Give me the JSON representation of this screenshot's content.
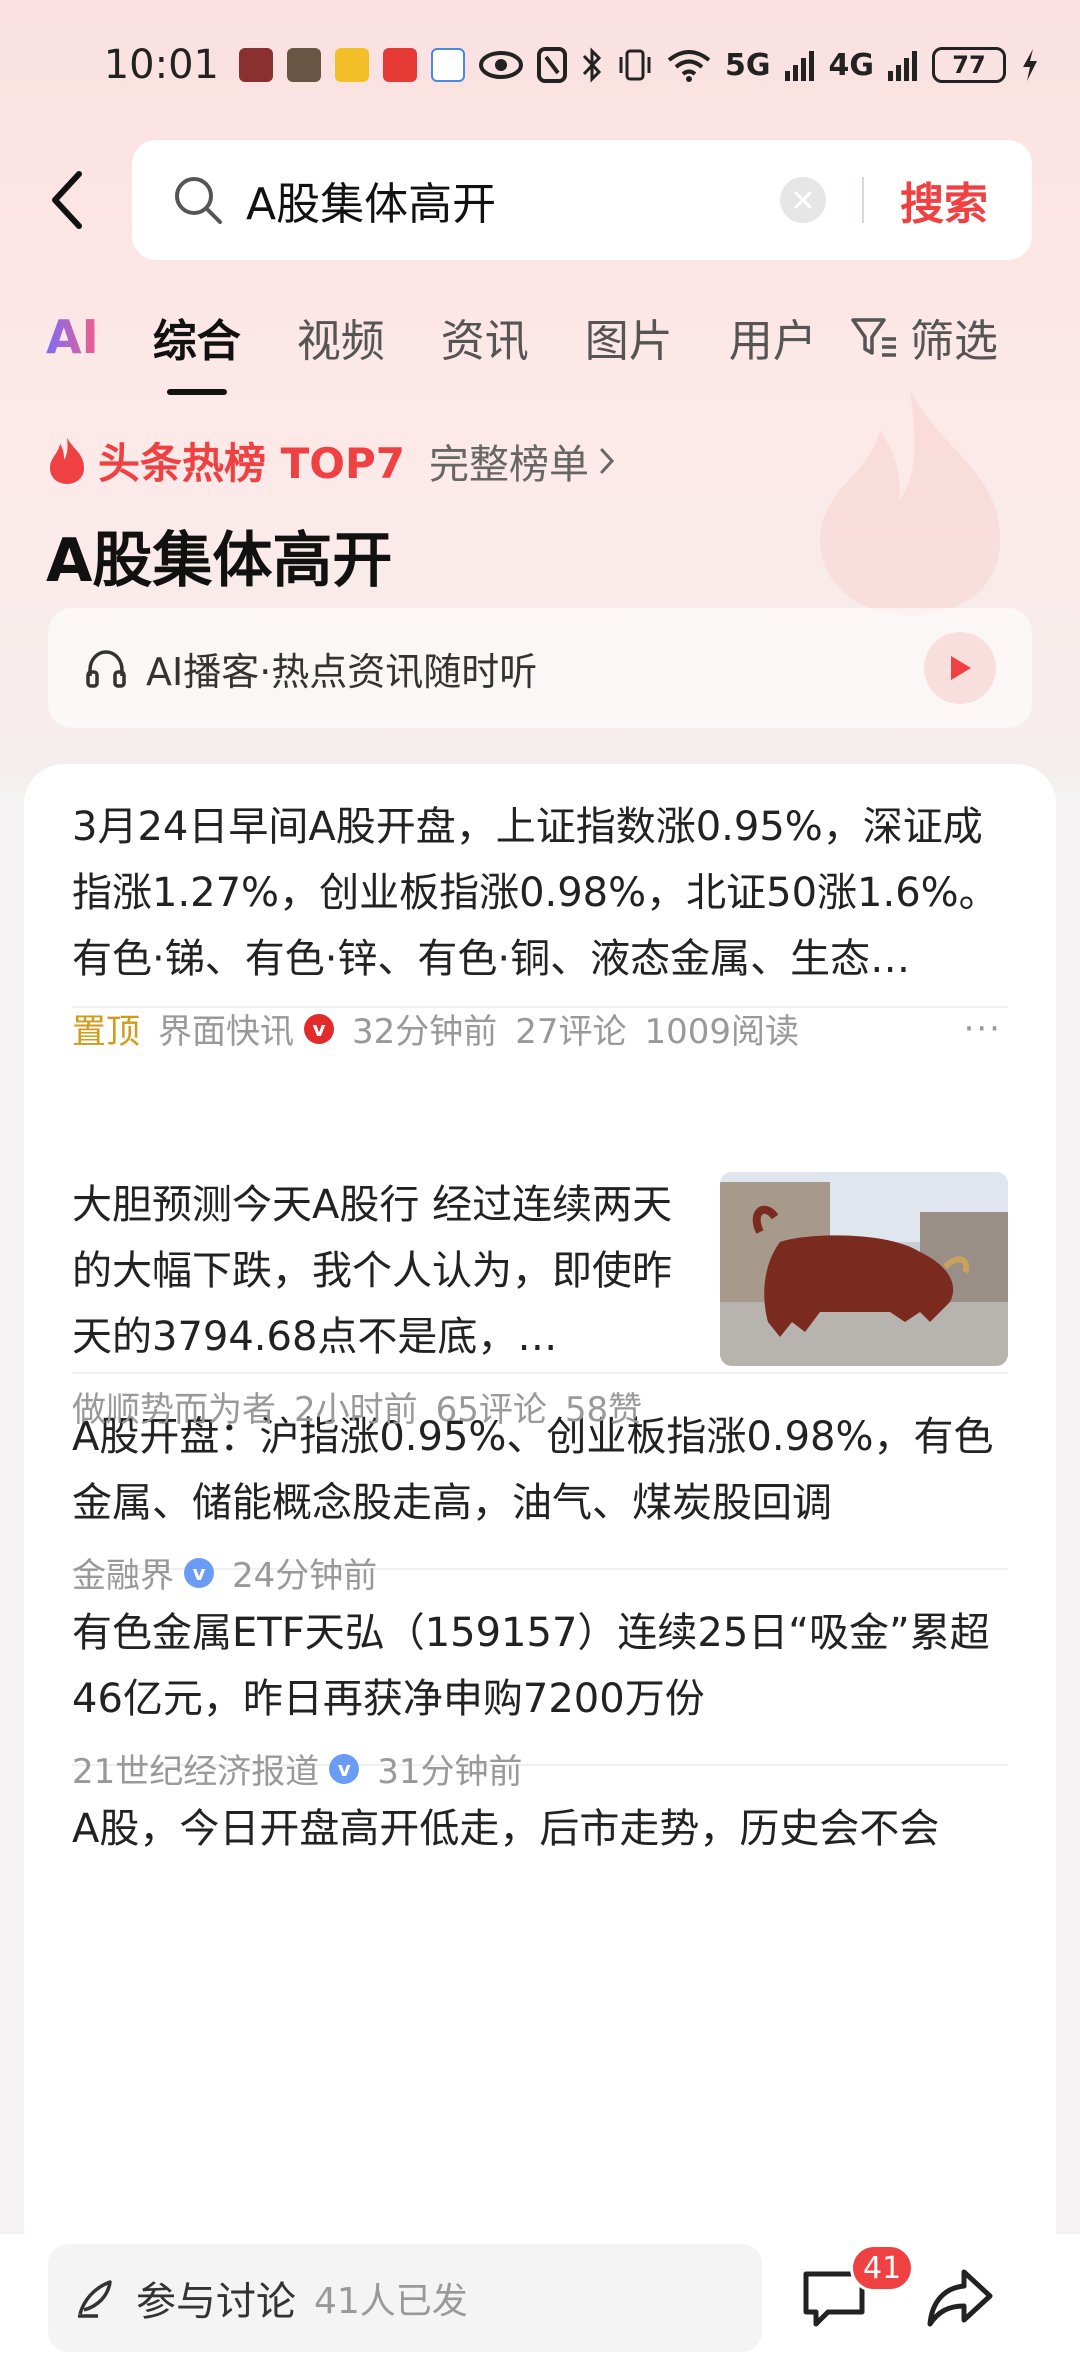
{
  "status_bar": {
    "time": "10:01",
    "net_5g": "5G",
    "net_4g": "4G",
    "battery": "77"
  },
  "search": {
    "query": "A股集体高开",
    "submit_label": "搜索"
  },
  "tabs": {
    "ai": "AI",
    "items": [
      "综合",
      "视频",
      "资讯",
      "图片",
      "用户"
    ],
    "filter": "筛选"
  },
  "hot": {
    "title": "头条热榜 TOP7",
    "link": "完整榜单",
    "headline": "A股集体高开"
  },
  "podcast": {
    "text": "AI播客·热点资讯随时听"
  },
  "results": [
    {
      "title": "3月24日早间A股开盘，上证指数涨0.95%，深证成指涨1.27%，创业板指涨0.98%，北证50涨1.6%。有色·锑、有色·锌、有色·铜、液态金属、生态…",
      "pinned": "置顶",
      "source": "界面快讯",
      "time": "32分钟前",
      "comments": "27评论",
      "reads": "1009阅读"
    },
    {
      "title": "大胆预测今天A股行 经过连续两天的大幅下跌，我个人认为，即使昨天的3794.68点不是底，…",
      "source": "做顺势而为者",
      "time": "2小时前",
      "comments": "65评论",
      "likes": "58赞"
    },
    {
      "title": "A股开盘：沪指涨0.95%、创业板指涨0.98%，有色金属、储能概念股走高，油气、煤炭股回调",
      "source": "金融界",
      "time": "24分钟前"
    },
    {
      "title": "有色金属ETF天弘（159157）连续25日“吸金”累超46亿元，昨日再获净申购7200万份",
      "source": "21世纪经济报道",
      "time": "31分钟前"
    },
    {
      "title": "A股，今日开盘高开低走，后市走势，历史会不会"
    }
  ],
  "bottom": {
    "discuss_label": "参与讨论",
    "discuss_count": "41人已发",
    "comment_badge": "41"
  },
  "colors": {
    "accent": "#f04142",
    "pinned": "#d39a1a",
    "meta": "#999999"
  }
}
